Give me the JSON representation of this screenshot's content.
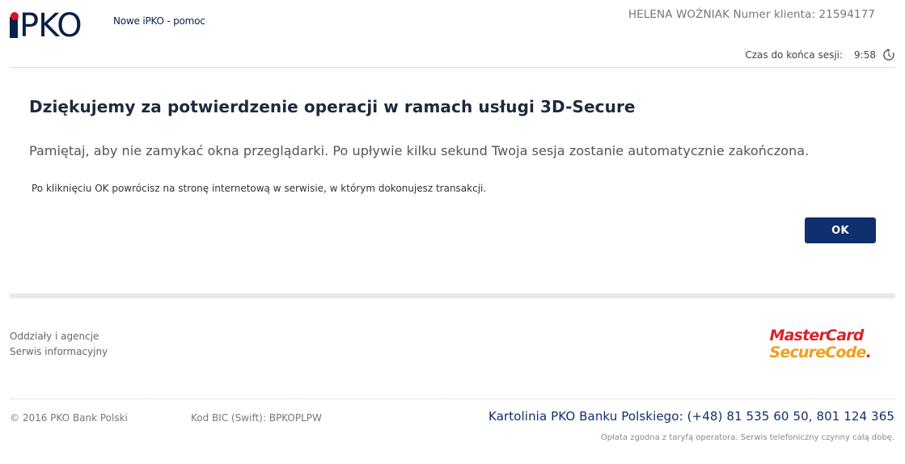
{
  "header": {
    "logo_text": "PKO",
    "logo_prefix": "i",
    "help_link": "Nowe iPKO - pomoc",
    "user_info": "HELENA WOŹNIAK Numer klienta: 21594177",
    "session_label": "Czas do końca sesji:",
    "session_time": "9:58",
    "timer_icon": "timer-icon"
  },
  "main": {
    "title": "Dziękujemy za potwierdzenie operacji w ramach usługi 3D-Secure",
    "subtitle": "Pamiętaj, aby nie zamykać okna przeglądarki. Po upływie kilku sekund Twoja sesja zostanie automatycznie zakończona.",
    "note": "Po kliknięciu OK powrócisz na stronę internetową w serwisie, w którym dokonujesz transakcji.",
    "ok_label": "OK"
  },
  "footer": {
    "links": [
      "Oddziały i agencje",
      "Serwis informacyjny"
    ],
    "securecode_top": "MasterCard",
    "securecode_bottom": "SecureCode",
    "copyright": "© 2016 PKO Bank Polski",
    "bic": "Kod BIC (Swift): BPKOPLPW",
    "hotline": "Kartolinia PKO Banku Polskiego: (+48) 81 535 60 50, 801 124 365",
    "hotline_note": "Opłata zgodna z taryfą operatora. Serwis telefoniczny czynny całą dobę."
  },
  "colors": {
    "brand_navy": "#0f2f6e",
    "brand_red": "#e0101a",
    "securecode_red": "#d9232a",
    "securecode_orange": "#f29e1b"
  }
}
